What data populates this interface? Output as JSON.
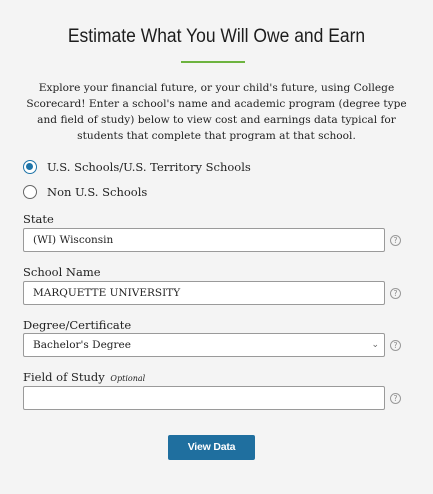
{
  "page": {
    "title": "Estimate What You Will Owe and Earn",
    "intro": "Explore your financial future, or your child's future, using College Scorecard! Enter a school's name and academic program (degree type and field of study) below to view cost and earnings data typical for students that complete that program at that school."
  },
  "school_type": {
    "options": [
      {
        "label": "U.S. Schools/U.S. Territory Schools",
        "selected": true
      },
      {
        "label": "Non U.S. Schools",
        "selected": false
      }
    ]
  },
  "form": {
    "state": {
      "label": "State",
      "value": "(WI) Wisconsin"
    },
    "school_name": {
      "label": "School Name",
      "value": "MARQUETTE UNIVERSITY"
    },
    "degree": {
      "label": "Degree/Certificate",
      "value": "Bachelor's Degree"
    },
    "field_of_study": {
      "label": "Field of Study",
      "optional_text": "Optional",
      "value": ""
    },
    "help_glyph": "?"
  },
  "actions": {
    "view_data_label": "View Data"
  },
  "colors": {
    "accent": "#1f6f9f",
    "title_rule": "#6db33f",
    "background": "#f4f4f4"
  }
}
